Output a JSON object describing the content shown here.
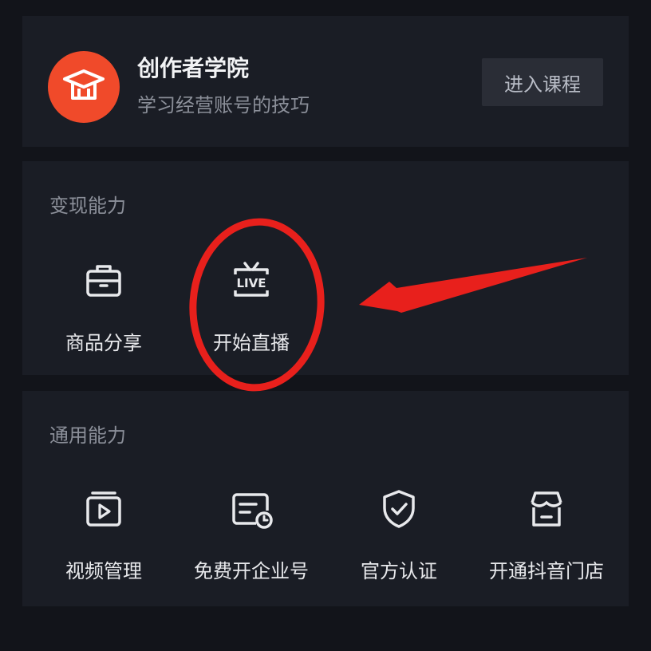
{
  "academy": {
    "title": "创作者学院",
    "subtitle": "学习经营账号的技巧",
    "enter_button": "进入课程",
    "logo_icon": "graduation-cap-icon",
    "logo_color": "#f04a2a"
  },
  "monetize": {
    "title": "变现能力",
    "items": [
      {
        "label": "商品分享",
        "icon": "briefcase-icon"
      },
      {
        "label": "开始直播",
        "icon": "live-tv-icon",
        "icon_text": "LIVE"
      }
    ]
  },
  "general": {
    "title": "通用能力",
    "items": [
      {
        "label": "视频管理",
        "icon": "video-folder-icon"
      },
      {
        "label": "免费开企业号",
        "icon": "enterprise-card-icon"
      },
      {
        "label": "官方认证",
        "icon": "shield-check-icon"
      },
      {
        "label": "开通抖音门店",
        "icon": "storefront-icon"
      }
    ]
  },
  "annotation": {
    "color": "#e8201c",
    "shapes": [
      "highlight-circle",
      "pointer-arrow"
    ]
  }
}
